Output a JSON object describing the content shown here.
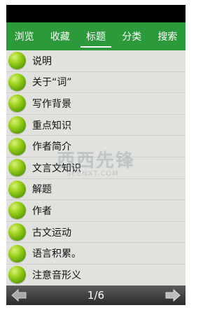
{
  "tabs": [
    {
      "label": "浏览"
    },
    {
      "label": "收藏"
    },
    {
      "label": "标题",
      "active": true
    },
    {
      "label": "分类"
    },
    {
      "label": "搜索"
    }
  ],
  "items": [
    {
      "label": "说明"
    },
    {
      "label": "关于“词”"
    },
    {
      "label": "写作背景"
    },
    {
      "label": "重点知识"
    },
    {
      "label": "作者简介"
    },
    {
      "label": "文言文知识"
    },
    {
      "label": "解题"
    },
    {
      "label": "作者"
    },
    {
      "label": "古文运动"
    },
    {
      "label": "语言积累。"
    },
    {
      "label": "注意音形义"
    }
  ],
  "watermark": {
    "text": "西西先锋",
    "sub": "SEENXT.COM"
  },
  "pager": {
    "label": "1/6"
  },
  "colors": {
    "tab_bar": "#2c9a3b",
    "list_bg": "#e1e1de",
    "bullet": "#7cc214"
  },
  "icons": {
    "prev": "arrow-left-icon",
    "next": "arrow-right-icon",
    "bullet": "green-ball-icon"
  }
}
